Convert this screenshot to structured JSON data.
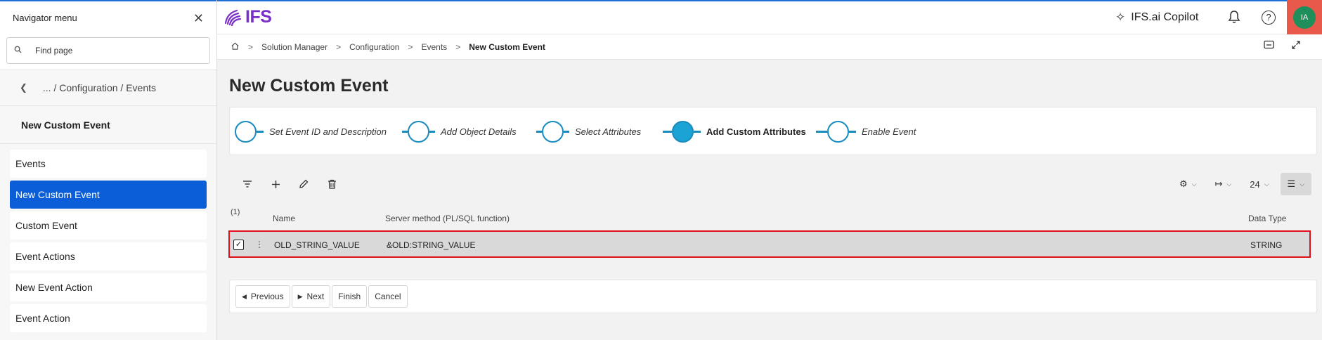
{
  "navigator": {
    "title": "Navigator menu",
    "search_placeholder": "Find page",
    "back_path": "... / Configuration / Events",
    "current": "New Custom Event",
    "items": [
      {
        "label": "Events"
      },
      {
        "label": "New Custom Event",
        "active": true
      },
      {
        "label": "Custom Event"
      },
      {
        "label": "Event Actions"
      },
      {
        "label": "New Event Action"
      },
      {
        "label": "Event Action"
      }
    ]
  },
  "header": {
    "logo_text": "IFS",
    "copilot_label": "IFS.ai Copilot",
    "avatar_initials": "IA"
  },
  "breadcrumb": {
    "items": [
      "Solution Manager",
      "Configuration",
      "Events"
    ],
    "current": "New Custom Event"
  },
  "page": {
    "title": "New Custom Event"
  },
  "wizard": {
    "steps": [
      {
        "label": "Set Event ID and Description"
      },
      {
        "label": "Add Object Details"
      },
      {
        "label": "Select Attributes"
      },
      {
        "label": "Add Custom Attributes",
        "current": true
      },
      {
        "label": "Enable Event"
      }
    ]
  },
  "toolbar": {
    "page_size": "24"
  },
  "table": {
    "selection_count": "(1)",
    "columns": {
      "name": "Name",
      "server_method": "Server method (PL/SQL function)",
      "data_type": "Data Type"
    },
    "rows": [
      {
        "name": "OLD_STRING_VALUE",
        "server_method": "&OLD:STRING_VALUE",
        "data_type": "STRING",
        "checked": true
      }
    ]
  },
  "buttons": {
    "previous": "Previous",
    "next": "Next",
    "finish": "Finish",
    "cancel": "Cancel"
  },
  "colors": {
    "accent_blue": "#0b5ed7",
    "wizard_blue": "#1a8bbf",
    "brand_purple": "#7b2fc9",
    "avatar_green": "#1e8e5a",
    "highlight_red": "#e0101a"
  }
}
